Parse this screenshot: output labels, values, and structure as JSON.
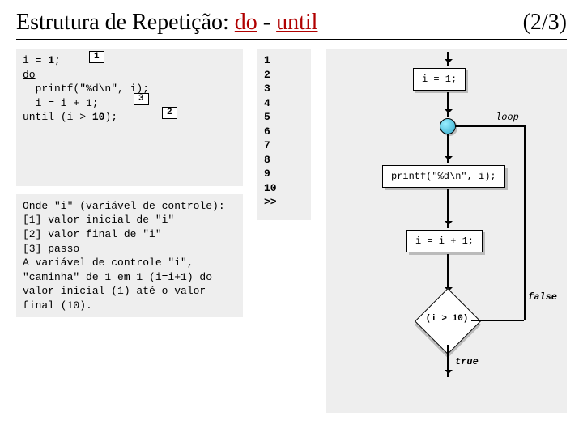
{
  "title_prefix": "Estrutura de Repetição: ",
  "title_kw1": "do",
  "title_sep": " - ",
  "title_kw2": "until",
  "page_label": "(2/3)",
  "code": {
    "l1a": "i = ",
    "l1b": "1",
    "l1c": ";",
    "l2": "do",
    "l3": "  printf(\"%d\\n\", i);",
    "l4": "  i = i + 1;",
    "l5a": "until",
    "l5b": " (i > ",
    "l5c": "10",
    "l5d": ");"
  },
  "badges": {
    "b1": "1",
    "b2": "2",
    "b3": "3"
  },
  "desc": "Onde \"i\" (variável de controle):\n[1] valor inicial de \"i\"\n[2] valor final de \"i\"\n[3] passo\nA variável de controle \"i\", \"caminha\" de 1 em 1 (i=i+1) do valor inicial (1) até o valor final (10).",
  "output": "1\n2\n3\n4\n5\n6\n7\n8\n9\n10\n>>",
  "flow": {
    "init": "i = 1;",
    "loop_label": "loop",
    "body": "printf(\"%d\\n\", i);",
    "step": "i = i + 1;",
    "cond": "(i > 10)",
    "true": "true",
    "false": "false"
  }
}
